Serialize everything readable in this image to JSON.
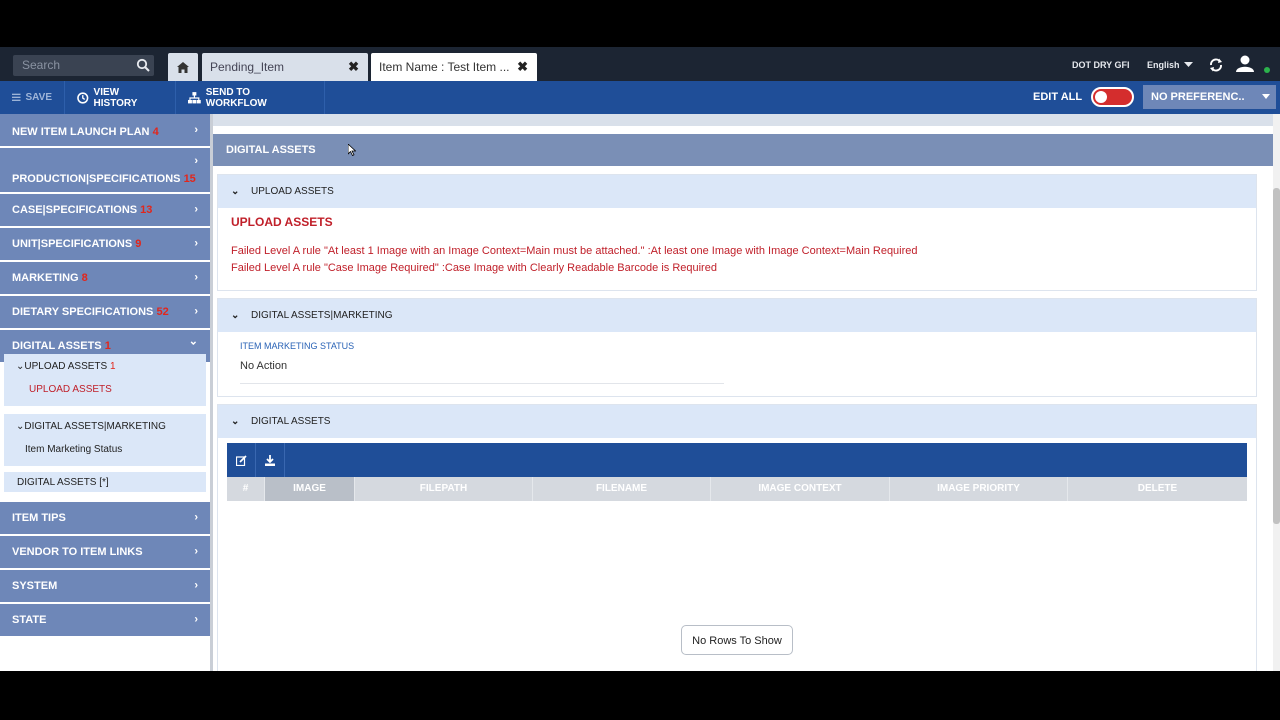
{
  "tabbar": {
    "search_placeholder": "Search",
    "tabs": [
      {
        "label": "Pending_Item",
        "close": "✖"
      },
      {
        "label": "Item Name : Test Item ...",
        "close": "✖"
      }
    ],
    "user": "DOT DRY GFI",
    "language": "English"
  },
  "toolbar": {
    "save": "SAVE",
    "history": "VIEW HISTORY",
    "workflow": "SEND TO WORKFLOW",
    "edit_all": "EDIT ALL",
    "edit_all_on": false,
    "preference": "NO PREFERENC.."
  },
  "sidebar": {
    "items": [
      {
        "label": "NEW ITEM LAUNCH PLAN",
        "count": "4",
        "chev": "›"
      },
      {
        "label": "PRODUCTION|SPECIFICATIONS",
        "count": "15",
        "chev": "›"
      },
      {
        "label": "CASE|SPECIFICATIONS",
        "count": "13",
        "chev": "›"
      },
      {
        "label": "UNIT|SPECIFICATIONS",
        "count": "9",
        "chev": "›"
      },
      {
        "label": "MARKETING",
        "count": "8",
        "chev": "›"
      },
      {
        "label": "DIETARY SPECIFICATIONS",
        "count": "52",
        "chev": "›"
      },
      {
        "label": "DIGITAL ASSETS",
        "count": "1",
        "chev": "⌄"
      },
      {
        "label": "ITEM TIPS",
        "count": "",
        "chev": "›"
      },
      {
        "label": "VENDOR TO ITEM LINKS",
        "count": "",
        "chev": "›"
      },
      {
        "label": "SYSTEM",
        "count": "",
        "chev": "›"
      },
      {
        "label": "STATE",
        "count": "",
        "chev": "›"
      }
    ],
    "subs": [
      {
        "label": "UPLOAD ASSETS",
        "count": "1",
        "child": "UPLOAD ASSETS"
      },
      {
        "label": "DIGITAL ASSETS|MARKETING",
        "count": "",
        "child": "Item Marketing Status"
      },
      {
        "label": "DIGITAL ASSETS [*]",
        "count": "",
        "child": ""
      }
    ]
  },
  "main": {
    "section_title": "DIGITAL ASSETS",
    "upload_panel": {
      "header": "UPLOAD ASSETS",
      "title": "UPLOAD ASSETS",
      "errors": [
        "Failed Level A rule \"At least 1 Image with an Image Context=Main must be attached.\" :At least one Image with Image Context=Main Required",
        "Failed Level A rule \"Case Image Required\" :Case Image with Clearly Readable Barcode is Required"
      ]
    },
    "marketing_panel": {
      "header": "DIGITAL ASSETS|MARKETING",
      "field_label": "ITEM MARKETING STATUS",
      "field_value": "No Action"
    },
    "assets_panel": {
      "header": "DIGITAL ASSETS",
      "columns": [
        "#",
        "IMAGE",
        "FILEPATH",
        "FILENAME",
        "IMAGE CONTEXT",
        "IMAGE PRIORITY",
        "DELETE"
      ],
      "empty_message": "No Rows To Show"
    }
  },
  "colors": {
    "toolbar": "#1f4e98",
    "sidebar": "#6e87b8",
    "error": "#c0202a",
    "count": "#e2261b"
  }
}
